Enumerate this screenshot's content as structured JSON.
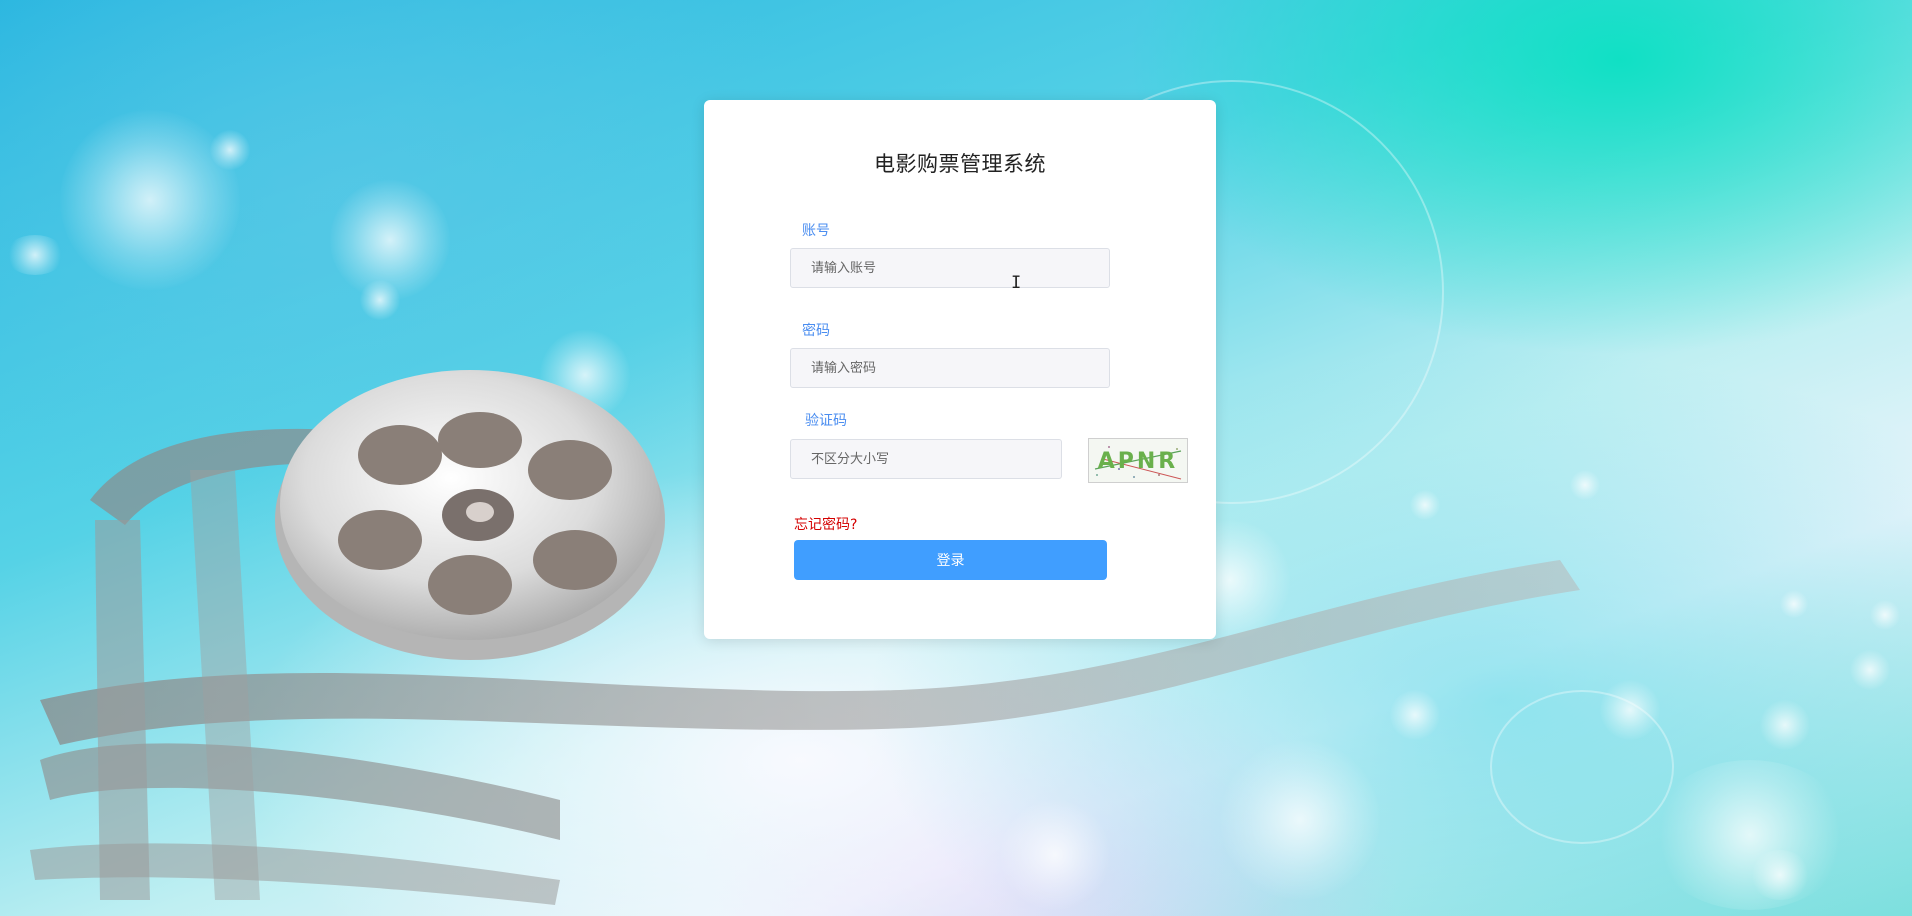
{
  "app": {
    "title": "电影购票管理系统"
  },
  "login": {
    "account_label": "账号",
    "account_placeholder": "请输入账号",
    "account_value": "",
    "password_label": "密码",
    "password_placeholder": "请输入密码",
    "password_value": "",
    "captcha_label": "验证码",
    "captcha_placeholder": "不区分大小写",
    "captcha_value": "",
    "captcha_code": "APNR",
    "forgot_label": "忘记密码?",
    "submit_label": "登录"
  },
  "colors": {
    "accent": "#409eff",
    "label": "#4a8df0",
    "forgot": "#d40000",
    "background_teal": "#00e2be"
  },
  "icons": {
    "cursor": "text-cursor-icon"
  }
}
